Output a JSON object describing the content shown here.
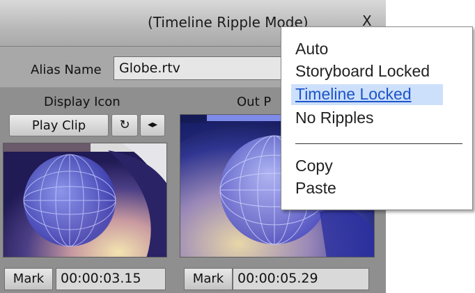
{
  "window": {
    "title": "(Timeline Ripple Mode)",
    "close_label": "X"
  },
  "alias": {
    "label": "Alias Name",
    "value": "Globe.rtv"
  },
  "display_icon": {
    "label": "Display Icon",
    "play_clip_label": "Play Clip",
    "loop_icon_glyph": "↻",
    "step_icon_glyph": "◂▸",
    "mark_label": "Mark",
    "timecode": "00:00:03.15"
  },
  "out_point": {
    "label_visible": "Out P",
    "mark_label": "Mark",
    "timecode": "00:00:05.29"
  },
  "context_menu": {
    "items": [
      {
        "label": "Auto"
      },
      {
        "label": "Storyboard Locked"
      },
      {
        "label": "Timeline Locked"
      },
      {
        "label": "No Ripples"
      },
      {
        "label": "Copy"
      },
      {
        "label": "Paste"
      }
    ],
    "highlighted_item": "Timeline Locked",
    "highlight_color": "#cde0fb"
  }
}
